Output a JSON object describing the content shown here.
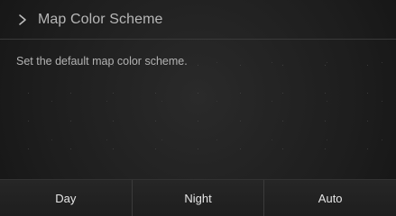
{
  "header": {
    "title": "Map Color Scheme",
    "back_icon": "chevron-right-icon"
  },
  "description": "Set the default map color scheme.",
  "options": [
    {
      "label": "Day"
    },
    {
      "label": "Night"
    },
    {
      "label": "Auto"
    }
  ]
}
